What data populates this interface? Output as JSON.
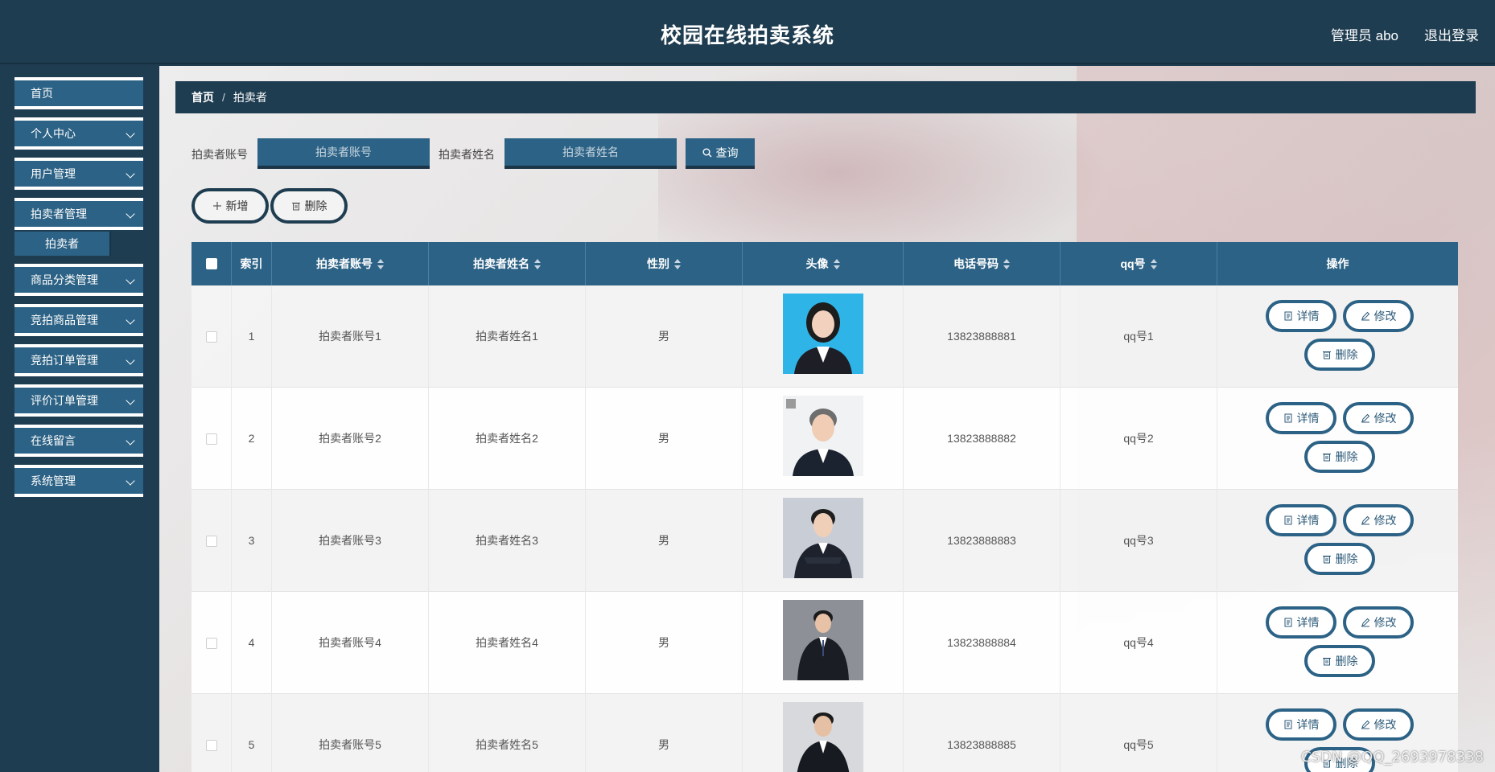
{
  "header": {
    "title": "校园在线拍卖系统",
    "user": "管理员 abo",
    "logout": "退出登录"
  },
  "sidebar": {
    "items": [
      {
        "label": "首页"
      },
      {
        "label": "个人中心"
      },
      {
        "label": "用户管理"
      },
      {
        "label": "拍卖者管理",
        "sub": "拍卖者"
      },
      {
        "label": "商品分类管理"
      },
      {
        "label": "竞拍商品管理"
      },
      {
        "label": "竞拍订单管理"
      },
      {
        "label": "评价订单管理"
      },
      {
        "label": "在线留言"
      },
      {
        "label": "系统管理"
      }
    ]
  },
  "breadcrumb": {
    "home": "首页",
    "separator": "/",
    "current": "拍卖者"
  },
  "search": {
    "account_label": "拍卖者账号",
    "account_placeholder": "拍卖者账号",
    "name_label": "拍卖者姓名",
    "name_placeholder": "拍卖者姓名",
    "query": "查询"
  },
  "actions": {
    "add": "新增",
    "delete": "删除"
  },
  "table": {
    "columns": [
      "索引",
      "拍卖者账号",
      "拍卖者姓名",
      "性别",
      "头像",
      "电话号码",
      "qq号",
      "操作"
    ],
    "rows": [
      {
        "index": "1",
        "account": "拍卖者账号1",
        "name": "拍卖者姓名1",
        "gender": "男",
        "phone": "13823888881",
        "qq": "qq号1"
      },
      {
        "index": "2",
        "account": "拍卖者账号2",
        "name": "拍卖者姓名2",
        "gender": "男",
        "phone": "13823888882",
        "qq": "qq号2"
      },
      {
        "index": "3",
        "account": "拍卖者账号3",
        "name": "拍卖者姓名3",
        "gender": "男",
        "phone": "13823888883",
        "qq": "qq号3"
      },
      {
        "index": "4",
        "account": "拍卖者账号4",
        "name": "拍卖者姓名4",
        "gender": "男",
        "phone": "13823888884",
        "qq": "qq号4"
      },
      {
        "index": "5",
        "account": "拍卖者账号5",
        "name": "拍卖者姓名5",
        "gender": "男",
        "phone": "13823888885",
        "qq": "qq号5"
      }
    ],
    "ops": {
      "detail": "详情",
      "edit": "修改",
      "delete": "删除"
    }
  },
  "watermark": "CSDN @QQ_2693978338",
  "colors": {
    "header": "#1f3d51",
    "accent": "#2c6285",
    "sidebar": "#1f3d51"
  },
  "icons": {
    "search": "search-icon",
    "add": "plus-icon",
    "delete": "trash-icon",
    "detail": "document-icon",
    "edit": "pencil-icon",
    "sort": "sort-icon",
    "expand": "chevron-down-icon"
  }
}
